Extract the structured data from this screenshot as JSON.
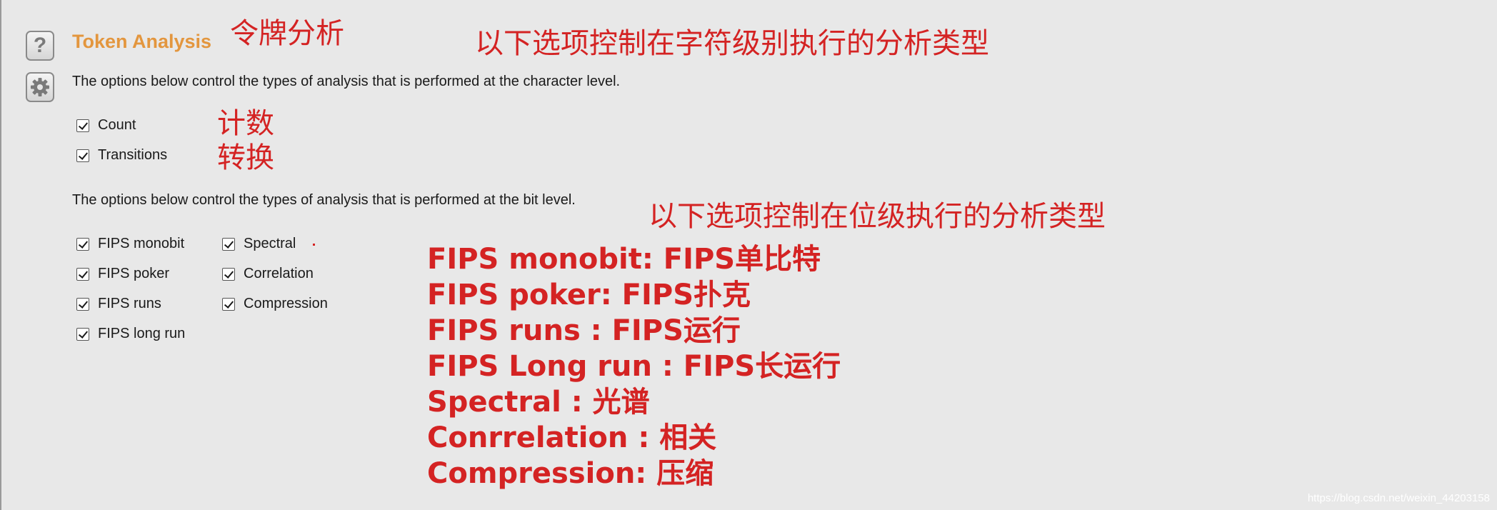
{
  "sidebar": {
    "help_icon_glyph": "?"
  },
  "header": {
    "title": "Token Analysis"
  },
  "character_section": {
    "description": "The options below control the types of analysis that is performed at the character level.",
    "options": [
      {
        "label": "Count",
        "checked": true
      },
      {
        "label": "Transitions",
        "checked": true
      }
    ]
  },
  "bit_section": {
    "description": "The options below control the types of analysis that is performed at the bit level.",
    "column1": [
      {
        "label": "FIPS monobit",
        "checked": true
      },
      {
        "label": "FIPS poker",
        "checked": true
      },
      {
        "label": "FIPS runs",
        "checked": true
      },
      {
        "label": "FIPS long run",
        "checked": true
      }
    ],
    "column2": [
      {
        "label": "Spectral",
        "checked": true
      },
      {
        "label": "Correlation",
        "checked": true
      },
      {
        "label": "Compression",
        "checked": true
      }
    ]
  },
  "annotations": {
    "title_cn": "令牌分析",
    "char_desc_cn": "以下选项控制在字符级别执行的分析类型",
    "count_cn": "计数",
    "transitions_cn": "转换",
    "bit_desc_cn": "以下选项控制在位级执行的分析类型",
    "glossary": [
      "FIPS monobit:  FIPS单比特",
      "FIPS poker:   FIPS扑克",
      "FIPS runs :   FIPS运行",
      "FIPS Long run :  FIPS长运行",
      "Spectral :   光谱",
      "Conrrelation :   相关",
      "Compression:    压缩"
    ]
  },
  "watermark": "https://blog.csdn.net/weixin_44203158",
  "colors": {
    "title": "#e3963e",
    "annotation": "#d42323",
    "background": "#e8e8e8"
  }
}
